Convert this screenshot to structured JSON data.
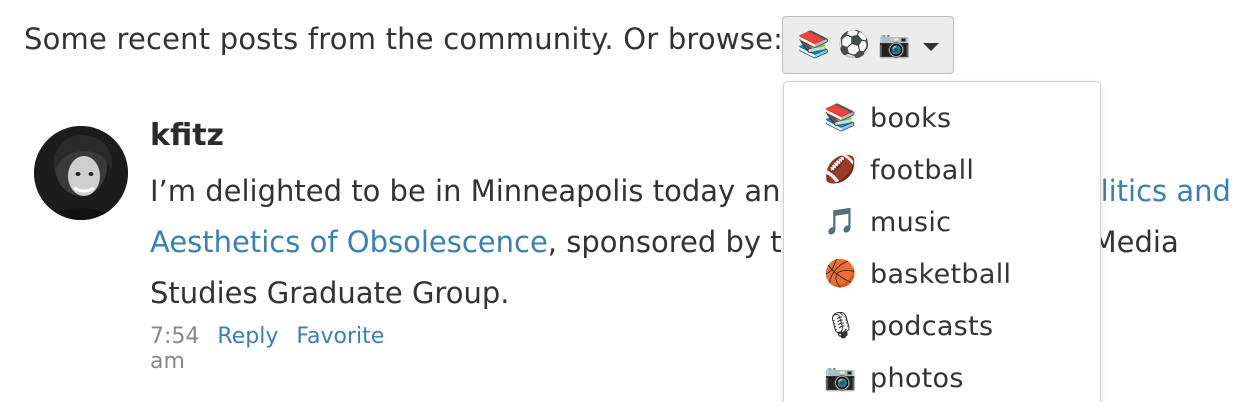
{
  "intro": {
    "text": "Some recent posts from the community. Or browse:"
  },
  "browse_button": {
    "icons": [
      "📚",
      "⚽",
      "📷"
    ]
  },
  "post": {
    "username": "kfitz",
    "text_part1": "I’m delighted to be in Minneapolis today an",
    "link_part1": "litics and",
    "link_part2": "Aesthetics of Obsolescence",
    "text_part2": ", sponsored by t",
    "text_part3": "Media",
    "text_part4": "Studies Graduate Group.",
    "time": "7:54 am",
    "reply_label": "Reply",
    "favorite_label": "Favorite"
  },
  "dropdown": {
    "items": [
      {
        "icon": "📚",
        "label": "books"
      },
      {
        "icon": "🏈",
        "label": "football"
      },
      {
        "icon": "🎵",
        "label": "music"
      },
      {
        "icon": "🏀",
        "label": "basketball"
      },
      {
        "icon": "🎙",
        "label": "podcasts"
      },
      {
        "icon": "📷",
        "label": "photos"
      }
    ]
  }
}
